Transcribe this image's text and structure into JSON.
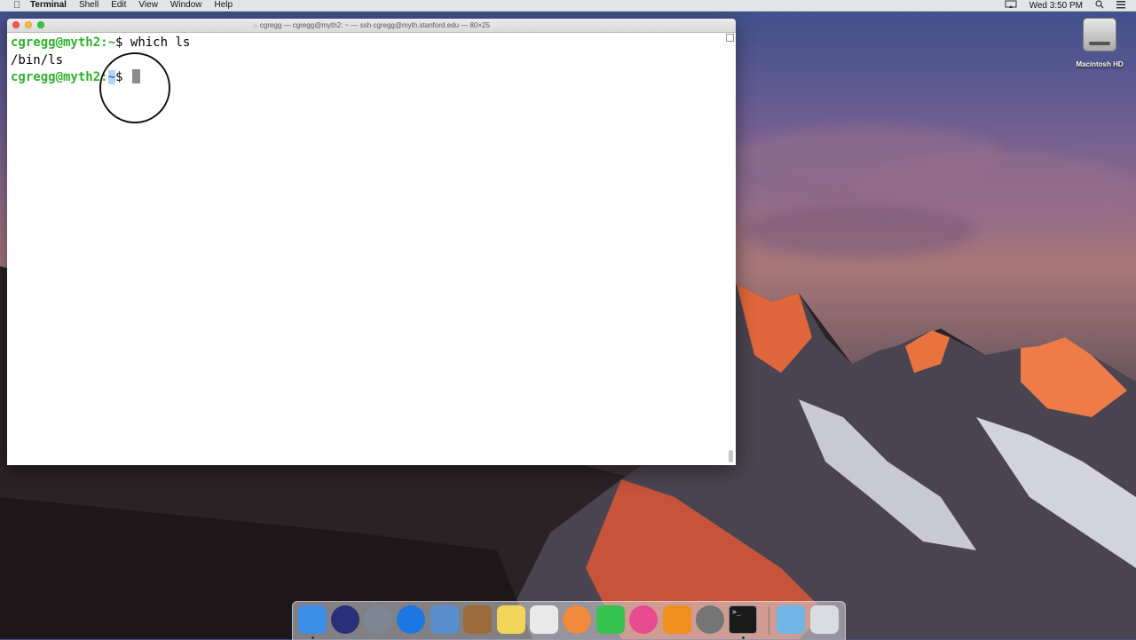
{
  "menubar": {
    "app_name": "Terminal",
    "menus": [
      "Shell",
      "Edit",
      "View",
      "Window",
      "Help"
    ],
    "clock": "Wed 3:50 PM"
  },
  "terminal": {
    "title": "cgregg — cgregg@myth2: ~ — ssh cgregg@myth.stanford.edu — 80×25",
    "lines": [
      {
        "prompt_user": "cgregg@myth2",
        "prompt_sep": ":",
        "prompt_dir": "~",
        "prompt_end": "$ ",
        "text": "which ls"
      },
      {
        "text": "/bin/ls"
      },
      {
        "prompt_user": "cgregg@myth2",
        "prompt_sep": ":",
        "prompt_dir": "~",
        "prompt_end": "$ ",
        "text": ""
      }
    ]
  },
  "desktop": {
    "hd_label": "Macintosh HD"
  },
  "dock": {
    "apps": [
      {
        "name": "finder-icon",
        "color": "#3d8ee8"
      },
      {
        "name": "siri-icon",
        "color": "#2a2f7a"
      },
      {
        "name": "launchpad-icon",
        "color": "#7e8793"
      },
      {
        "name": "safari-icon",
        "color": "#1b78e2"
      },
      {
        "name": "preview-icon",
        "color": "#5a8fcf"
      },
      {
        "name": "contacts-icon",
        "color": "#9b6b3c"
      },
      {
        "name": "notes-icon",
        "color": "#f3d45a"
      },
      {
        "name": "reminders-icon",
        "color": "#e9e9e9"
      },
      {
        "name": "photos-icon",
        "color": "#f08a3c"
      },
      {
        "name": "facetime-icon",
        "color": "#35c24f"
      },
      {
        "name": "itunes-icon",
        "color": "#e84b8f"
      },
      {
        "name": "ibooks-icon",
        "color": "#f08f1c"
      },
      {
        "name": "system-preferences-icon",
        "color": "#757575"
      },
      {
        "name": "terminal-icon",
        "color": "#1a1a1a"
      },
      {
        "name": "downloads-icon",
        "color": "#6fb6e6"
      },
      {
        "name": "trash-icon",
        "color": "#d9dde2"
      }
    ]
  }
}
